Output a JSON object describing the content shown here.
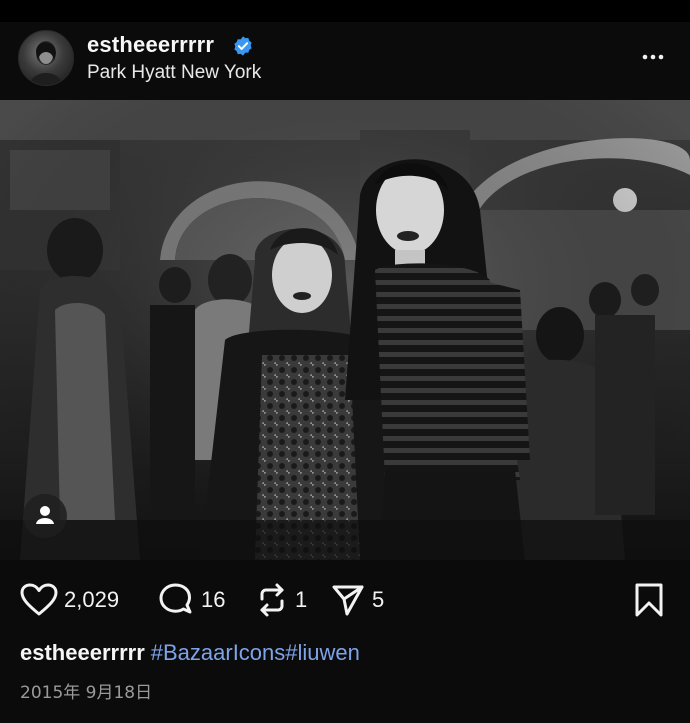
{
  "post": {
    "username": "estheeerrrrr",
    "location": "Park Hyatt New York",
    "verified": true,
    "photo_description_icon": "photo"
  },
  "actions": {
    "likes": "2,029",
    "comments": "16",
    "reposts": "1",
    "shares": "5"
  },
  "caption": {
    "username": "estheeerrrrr",
    "hashtags": "#BazaarIcons#liuwen"
  },
  "date": "2015年 9月18日",
  "colors": {
    "background": "#0b0b0b",
    "hashtag": "#7ea3e8",
    "verified_badge": "#3897f0",
    "muted_text": "#9a9a9a"
  },
  "icons": [
    "verified-badge-icon",
    "more-dots-icon",
    "user-tag-icon",
    "heart-icon",
    "comment-icon",
    "repost-icon",
    "share-icon",
    "bookmark-icon"
  ]
}
